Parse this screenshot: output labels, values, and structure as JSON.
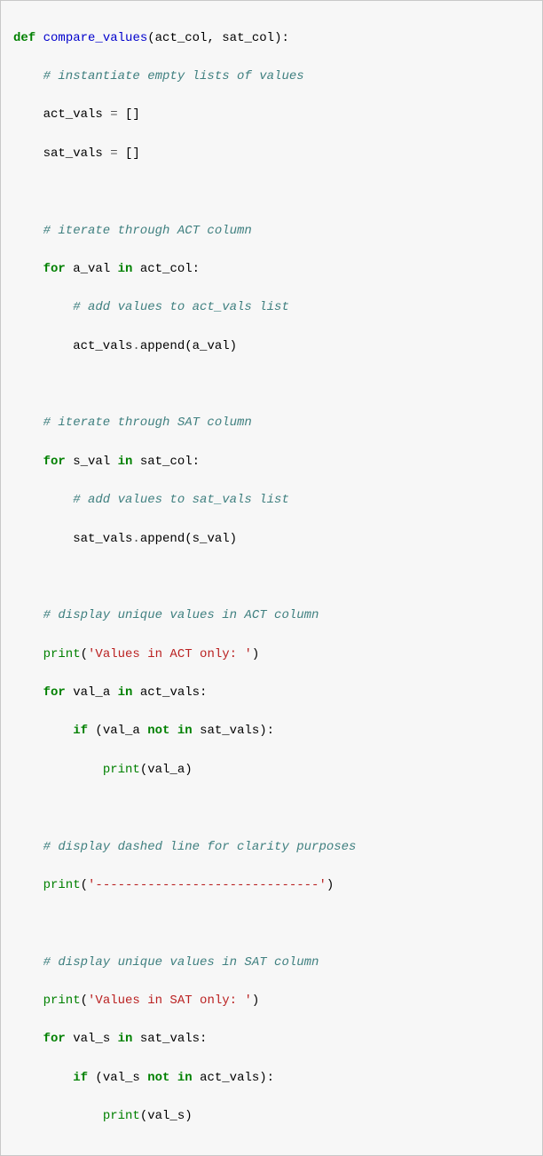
{
  "code": {
    "def": "def",
    "fn": "compare_values",
    "params_open": "(act_col, sat_col):",
    "c1": "# instantiate empty lists of values",
    "l2a": "act_vals ",
    "l2b": "=",
    "l2c": " []",
    "l3a": "sat_vals ",
    "l3b": "=",
    "l3c": " []",
    "c2": "# iterate through ACT column",
    "for": "for",
    "l5a": " a_val ",
    "in": "in",
    "l5b": " act_col:",
    "c3": "# add values to act_vals list",
    "l6a": "act_vals",
    "l6b": ".",
    "l6c": "append(a_val)",
    "c4": "# iterate through SAT column",
    "l8a": " s_val ",
    "l8b": " sat_col:",
    "c5": "# add values to sat_vals list",
    "l9a": "sat_vals",
    "l9b": ".",
    "l9c": "append(s_val)",
    "c6": "# display unique values in ACT column",
    "print": "print",
    "l11a": "(",
    "s1": "'Values in ACT only: '",
    "l11b": ")",
    "l12a": " val_a ",
    "l12b": " act_vals:",
    "if": "if",
    "l13a": " (val_a ",
    "not": "not",
    "l13b": " sat_vals):",
    "l14a": "(val_a)",
    "c7": "# display dashed line for clarity purposes",
    "l16a": "(",
    "s2": "'------------------------------'",
    "l16b": ")",
    "c8": "# display unique values in SAT column",
    "l18a": "(",
    "s3": "'Values in SAT only: '",
    "l18b": ")",
    "l19a": " val_s ",
    "l19b": " sat_vals:",
    "l20a": " (val_s ",
    "l20b": " act_vals):",
    "l21a": "(val_s)",
    "sp": " "
  }
}
